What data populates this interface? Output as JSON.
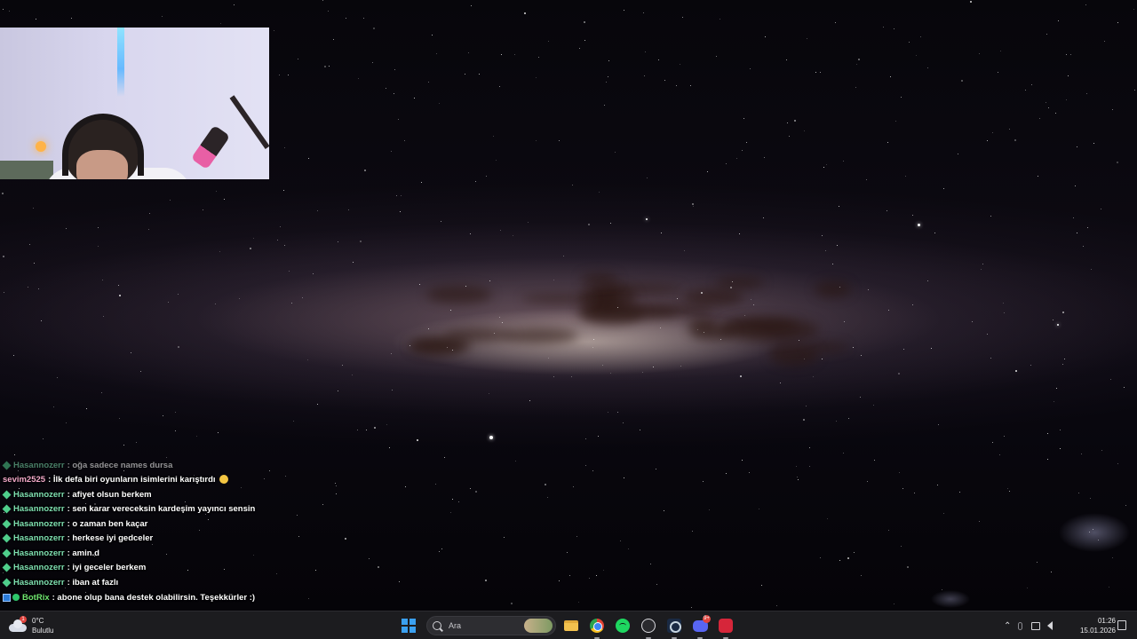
{
  "webcam": {
    "label": ""
  },
  "chat": {
    "messages": [
      {
        "user": "Hasannozerr",
        "text": ": oğa sadece names dursa",
        "user_color": "#7ee0b0",
        "badge": "diamond"
      },
      {
        "user": "sevim2525",
        "text": ": İlk defa biri oyunların isimlerini karıştırdı",
        "user_color": "#f2a8c8",
        "badge": "none",
        "emoji": "grinning-emoji"
      },
      {
        "user": "Hasannozerr",
        "text": ": afiyet olsun berkem",
        "user_color": "#7ee0b0",
        "badge": "diamond"
      },
      {
        "user": "Hasannozerr",
        "text": ": sen karar vereceksin kardeşim yayıncı sensin",
        "user_color": "#7ee0b0",
        "badge": "diamond"
      },
      {
        "user": "Hasannozerr",
        "text": ": o zaman ben kaçar",
        "user_color": "#7ee0b0",
        "badge": "diamond"
      },
      {
        "user": "Hasannozerr",
        "text": ": herkese iyi gedceler",
        "user_color": "#7ee0b0",
        "badge": "diamond"
      },
      {
        "user": "Hasannozerr",
        "text": ": amin.d",
        "user_color": "#7ee0b0",
        "badge": "diamond"
      },
      {
        "user": "Hasannozerr",
        "text": ": iyi geceler berkem",
        "user_color": "#7ee0b0",
        "badge": "diamond"
      },
      {
        "user": "Hasannozerr",
        "text": ": iban at fazlı",
        "user_color": "#7ee0b0",
        "badge": "diamond"
      },
      {
        "user": "BotRix",
        "text": ": abone olup bana destek olabilirsin. Teşekkürler :)",
        "user_color": "#6fe66f",
        "badge": "bot"
      }
    ]
  },
  "taskbar": {
    "weather": {
      "temperature": "0°C",
      "condition": "Bulutlu",
      "alert_count": "1"
    },
    "search": {
      "placeholder": "Ara"
    },
    "apps": [
      {
        "name": "file-explorer",
        "icon": "folder-icon"
      },
      {
        "name": "chrome",
        "icon": "chrome-icon"
      },
      {
        "name": "spotify",
        "icon": "spotify-icon"
      },
      {
        "name": "obs",
        "icon": "obs-icon"
      },
      {
        "name": "steam",
        "icon": "steam-icon"
      },
      {
        "name": "discord",
        "icon": "discord-icon",
        "badge": "9+"
      },
      {
        "name": "red-app",
        "icon": "red-app-icon"
      }
    ],
    "clock": {
      "time": "01:26",
      "date": "15.01.2026"
    }
  },
  "colors": {
    "taskbar_bg": "#1c1c1f",
    "accent": "#3aa0f0"
  }
}
